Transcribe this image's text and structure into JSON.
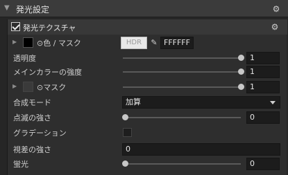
{
  "section": {
    "title": "発光設定"
  },
  "subsection": {
    "title": "発光テクスチャ",
    "enabled": true
  },
  "color_row": {
    "label": "⊙色 / マスク",
    "hdr_label": "HDR",
    "hex_value": "FFFFFF",
    "swatch_color": "#000000"
  },
  "transparency": {
    "label": "透明度",
    "value": "1",
    "fill": 1.0
  },
  "main_color_strength": {
    "label": "メインカラーの強度",
    "value": "1",
    "fill": 1.0
  },
  "mask_row": {
    "label": "⊙マスク",
    "value": "1",
    "fill": 1.0,
    "swatch_color": "#3a3a3a"
  },
  "blend_mode": {
    "label": "合成モード",
    "value": "加算"
  },
  "blink_strength": {
    "label": "点滅の強さ",
    "value": "0",
    "fill": 0.0
  },
  "gradation": {
    "label": "グラデーション",
    "checked": false
  },
  "parallax_strength": {
    "label": "視差の強さ",
    "value": "0"
  },
  "fluorescence": {
    "label": "蛍光",
    "value": "0",
    "fill": 0.0
  },
  "colors": {
    "header_bg": "#3b3b3b",
    "panel_bg": "#2e2e2e",
    "input_bg": "#1c1c1c",
    "knob": "#c7c7c7"
  }
}
